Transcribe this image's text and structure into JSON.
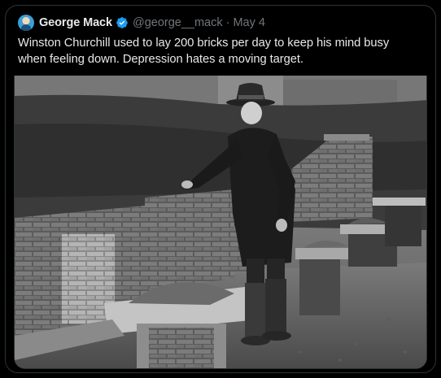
{
  "tweet": {
    "author_name": "George Mack",
    "handle": "@george__mack",
    "separator": "·",
    "date": "May 4",
    "verified": true,
    "text": "Winston Churchill used to lay 200 bricks per day to keep his mind busy when feeling down. Depression hates a moving target.",
    "media_description_icon": "photo-of-man-laying-bricks"
  },
  "colors": {
    "background": "#000000",
    "text": "#e7e9ea",
    "secondary_text": "#71767b",
    "verified_badge": "#1d9bf0",
    "border": "#2f3336"
  }
}
